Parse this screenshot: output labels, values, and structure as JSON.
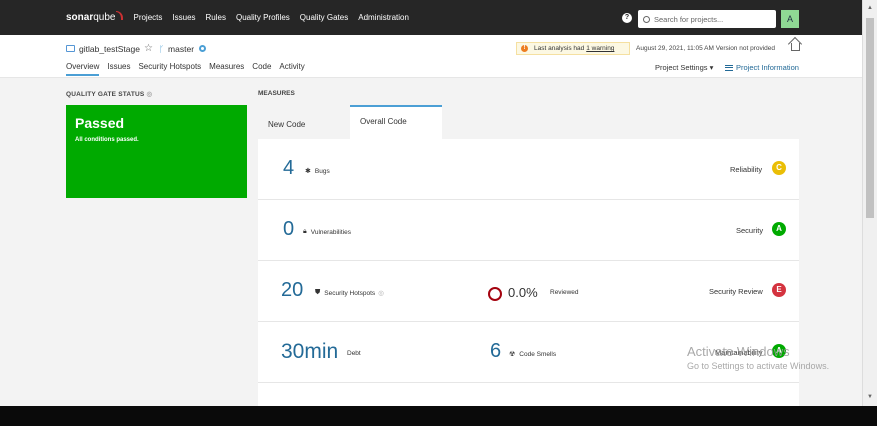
{
  "header": {
    "logo_bold": "sonar",
    "logo_light": "qube",
    "nav": [
      "Projects",
      "Issues",
      "Rules",
      "Quality Profiles",
      "Quality Gates",
      "Administration"
    ],
    "help_icon": "help-icon",
    "search_placeholder": "Search for projects...",
    "avatar_letter": "A"
  },
  "project": {
    "name": "gitlab_testStage",
    "branch": "master",
    "tabs": [
      "Overview",
      "Issues",
      "Security Hotspots",
      "Measures",
      "Code",
      "Activity"
    ],
    "warning_text": "Last analysis had",
    "warning_link": "1 warning",
    "analysis_info": "August 29, 2021, 11:05 AM  Version not provided",
    "settings_label": "Project Settings ▾",
    "info_label": "Project Information"
  },
  "quality_gate": {
    "title": "QUALITY GATE STATUS",
    "status": "Passed",
    "subtitle": "All conditions passed.",
    "color": "#00aa00"
  },
  "measures": {
    "title": "MEASURES",
    "tab_new": "New Code",
    "tab_overall": "Overall Code",
    "bugs": {
      "value": "4",
      "label": "Bugs",
      "rating_label": "Reliability",
      "rating": "C",
      "rating_color": "#eabe06"
    },
    "vulns": {
      "value": "0",
      "label": "Vulnerabilities",
      "rating_label": "Security",
      "rating": "A",
      "rating_color": "#00aa00"
    },
    "hotspots": {
      "value": "20",
      "label": "Security Hotspots",
      "reviewed_pct": "0.0%",
      "reviewed_label": "Reviewed",
      "rating_label": "Security Review",
      "rating": "E",
      "rating_color": "#d4333f"
    },
    "debt": {
      "value": "30min",
      "label": "Debt",
      "smells_value": "6",
      "smells_label": "Code Smells",
      "rating_label": "Maintainability",
      "rating": "A",
      "rating_color": "#00aa00"
    }
  },
  "watermark": {
    "line1": "Activate Windows",
    "line2": "Go to Settings to activate Windows."
  }
}
